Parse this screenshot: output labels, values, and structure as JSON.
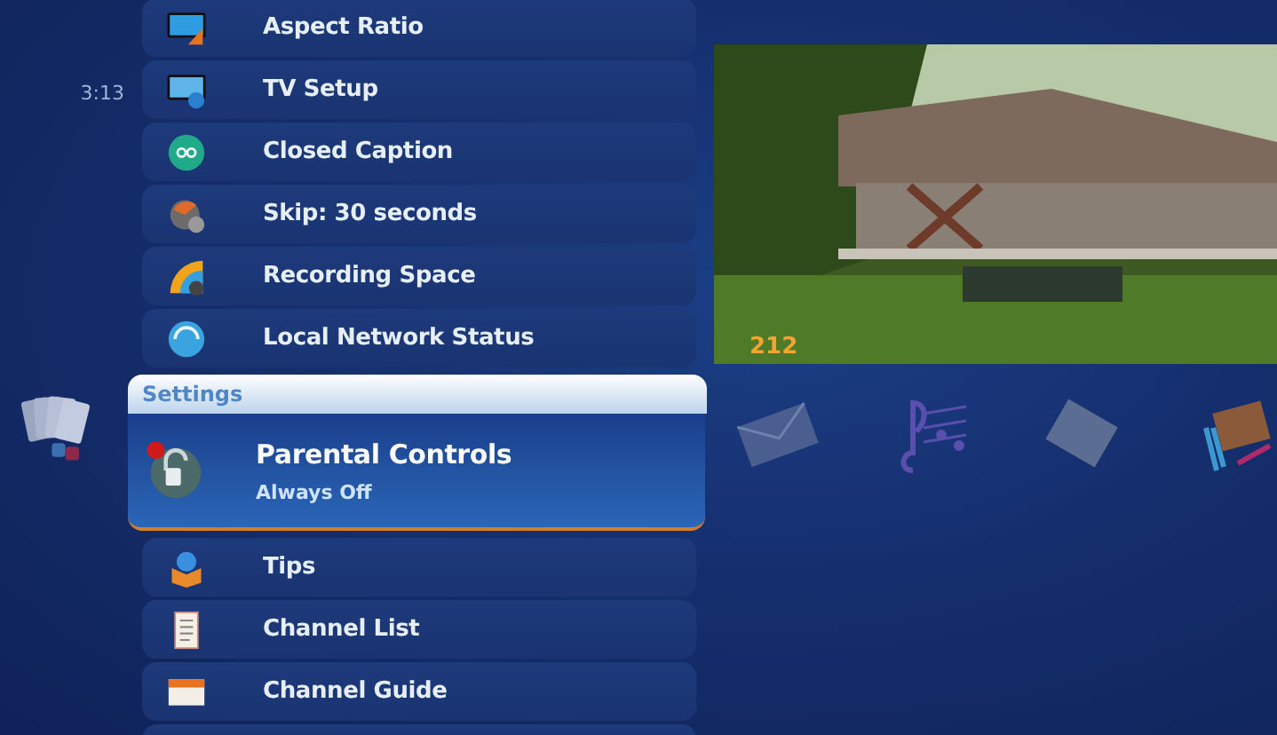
{
  "clock": "3:13",
  "menu": {
    "category": "Settings",
    "items": [
      {
        "label": "Aspect Ratio",
        "selected": false
      },
      {
        "label": "TV Setup",
        "selected": false
      },
      {
        "label": "Closed Caption",
        "selected": false
      },
      {
        "label": "Skip: 30 seconds",
        "selected": false
      },
      {
        "label": "Recording Space",
        "selected": false
      },
      {
        "label": "Local Network Status",
        "selected": false
      },
      {
        "label": "Parental Controls",
        "value": "Always Off",
        "selected": true
      },
      {
        "label": "Tips",
        "selected": false
      },
      {
        "label": "Channel List",
        "selected": false
      },
      {
        "label": "Channel Guide",
        "selected": false
      }
    ]
  },
  "preview": {
    "channel": "212"
  }
}
